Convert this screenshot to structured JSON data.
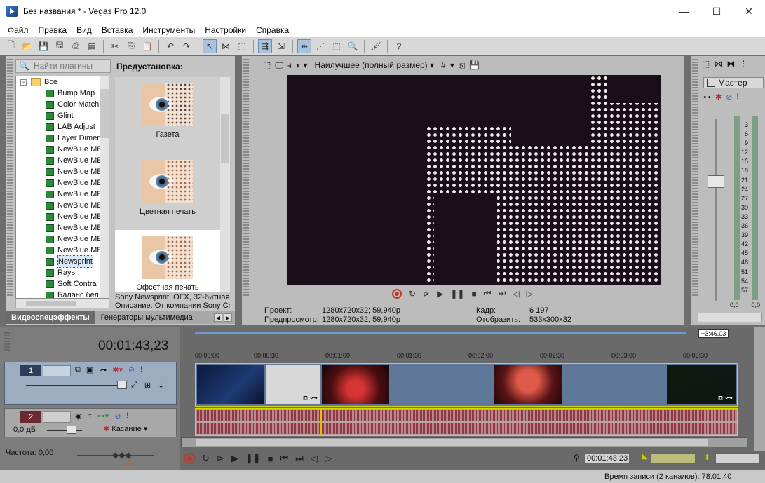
{
  "window": {
    "title": "Без названия * - Vegas Pro 12.0",
    "minimize": "—",
    "maximize": "☐",
    "close": "✕"
  },
  "menu": [
    "Файл",
    "Правка",
    "Вид",
    "Вставка",
    "Инструменты",
    "Настройки",
    "Справка"
  ],
  "fx": {
    "search_placeholder": "Найти плагины",
    "preset_title": "Предустановка:",
    "tree": [
      {
        "label": "Все",
        "root": true
      },
      {
        "label": "Bump Map"
      },
      {
        "label": "Color Match"
      },
      {
        "label": "Glint"
      },
      {
        "label": "LAB Adjust"
      },
      {
        "label": "Layer Dimer"
      },
      {
        "label": "NewBlue ME"
      },
      {
        "label": "NewBlue ME"
      },
      {
        "label": "NewBlue ME"
      },
      {
        "label": "NewBlue ME"
      },
      {
        "label": "NewBlue ME"
      },
      {
        "label": "NewBlue ME"
      },
      {
        "label": "NewBlue ME"
      },
      {
        "label": "NewBlue ME"
      },
      {
        "label": "NewBlue ME"
      },
      {
        "label": "NewBlue ME"
      },
      {
        "label": "Newsprint",
        "selected": true
      },
      {
        "label": "Rays"
      },
      {
        "label": "Soft Contra"
      },
      {
        "label": "Баланс бел"
      }
    ],
    "presets": [
      "Газета",
      "Цветная печать",
      "Офсетная печать"
    ],
    "info_line1": "Sony Newsprint: OFX, 32-битная",
    "info_line2": "Описание: От компании Sony Cre",
    "tabs": [
      "Видеоспецэффекты",
      "Генераторы мультимедиа"
    ]
  },
  "preview": {
    "quality": "Наилучшее (полный размер)",
    "project_label": "Проект:",
    "project_value": "1280x720x32; 59,940p",
    "preview_label": "Предпросмотр:",
    "preview_value": "1280x720x32; 59,940p",
    "frame_label": "Кадр:",
    "frame_value": "6 197",
    "display_label": "Отобразить:",
    "display_value": "533x300x32"
  },
  "mixer": {
    "master_label": "Мастер",
    "scale": [
      "3",
      "6",
      "9",
      "12",
      "15",
      "18",
      "21",
      "24",
      "27",
      "30",
      "33",
      "36",
      "39",
      "42",
      "45",
      "48",
      "51",
      "54",
      "57"
    ],
    "bottom_left": "0,0",
    "bottom_right": "0,0"
  },
  "timeline": {
    "timecode": "00:01:43,23",
    "range_label": "+3:46,03",
    "ruler": [
      "00:00:00",
      "00:00:30",
      "00:01:00",
      "00:01:30",
      "00:02:00",
      "00:02:30",
      "00:03:00",
      "00:03:30"
    ],
    "track1": {
      "number": "1"
    },
    "track2": {
      "number": "2",
      "volume": "0,0 дБ",
      "mode": "Касание"
    },
    "frequency": "Частота: 0,00",
    "cursor_timecode": "00:01:43,23",
    "status": "Время записи (2 каналов): 78:01:40"
  }
}
